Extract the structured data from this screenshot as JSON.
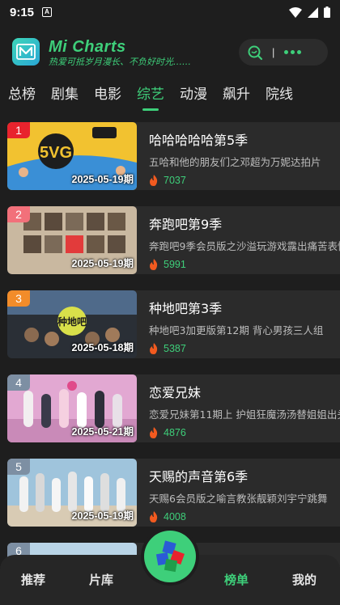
{
  "status_bar": {
    "time": "9:15",
    "notification_letter": "A"
  },
  "header": {
    "title": "Mi Charts",
    "slogan": "热爱可抵岁月漫长、不负好时光……",
    "pill_divider": "|",
    "brand_color": "#3ecf7a"
  },
  "tabs": [
    {
      "label": "总榜",
      "active": false
    },
    {
      "label": "剧集",
      "active": false
    },
    {
      "label": "电影",
      "active": false
    },
    {
      "label": "综艺",
      "active": true
    },
    {
      "label": "动漫",
      "active": false
    },
    {
      "label": "飙升",
      "active": false
    },
    {
      "label": "院线",
      "active": false
    }
  ],
  "items": [
    {
      "rank": "1",
      "date": "2025-05-19期",
      "title": "哈哈哈哈哈第5季",
      "desc": "五哈和他的朋友们之邓超为万妮达拍片",
      "heat": "7037",
      "badge_color": "#e8232d"
    },
    {
      "rank": "2",
      "date": "2025-05-19期",
      "title": "奔跑吧第9季",
      "desc": "奔跑吧9季会员版之沙溢玩游戏露出痛苦表情",
      "heat": "5991",
      "badge_color": "#f2707a"
    },
    {
      "rank": "3",
      "date": "2025-05-18期",
      "title": "种地吧第3季",
      "desc": "种地吧3加更版第12期 背心男孩三人组",
      "heat": "5387",
      "badge_color": "#f28c2a"
    },
    {
      "rank": "4",
      "date": "2025-05-21期",
      "title": "恋爱兄妹",
      "desc": "恋爱兄妹第11期上 护姐狂魔汤汤替姐姐出头",
      "heat": "4876",
      "badge_color": "#7d8fa3"
    },
    {
      "rank": "5",
      "date": "2025-05-19期",
      "title": "天赐的声音第6季",
      "desc": "天赐6会员版之喻言教张靓颖刘宇宁跳舞",
      "heat": "4008",
      "badge_color": "#7d8fa3"
    }
  ],
  "partial_item": {
    "rank": "6"
  },
  "bottom_nav": [
    {
      "label": "推荐",
      "active": false
    },
    {
      "label": "片库",
      "active": false
    },
    {
      "label": "榜单",
      "active": true
    },
    {
      "label": "我的",
      "active": false
    }
  ]
}
